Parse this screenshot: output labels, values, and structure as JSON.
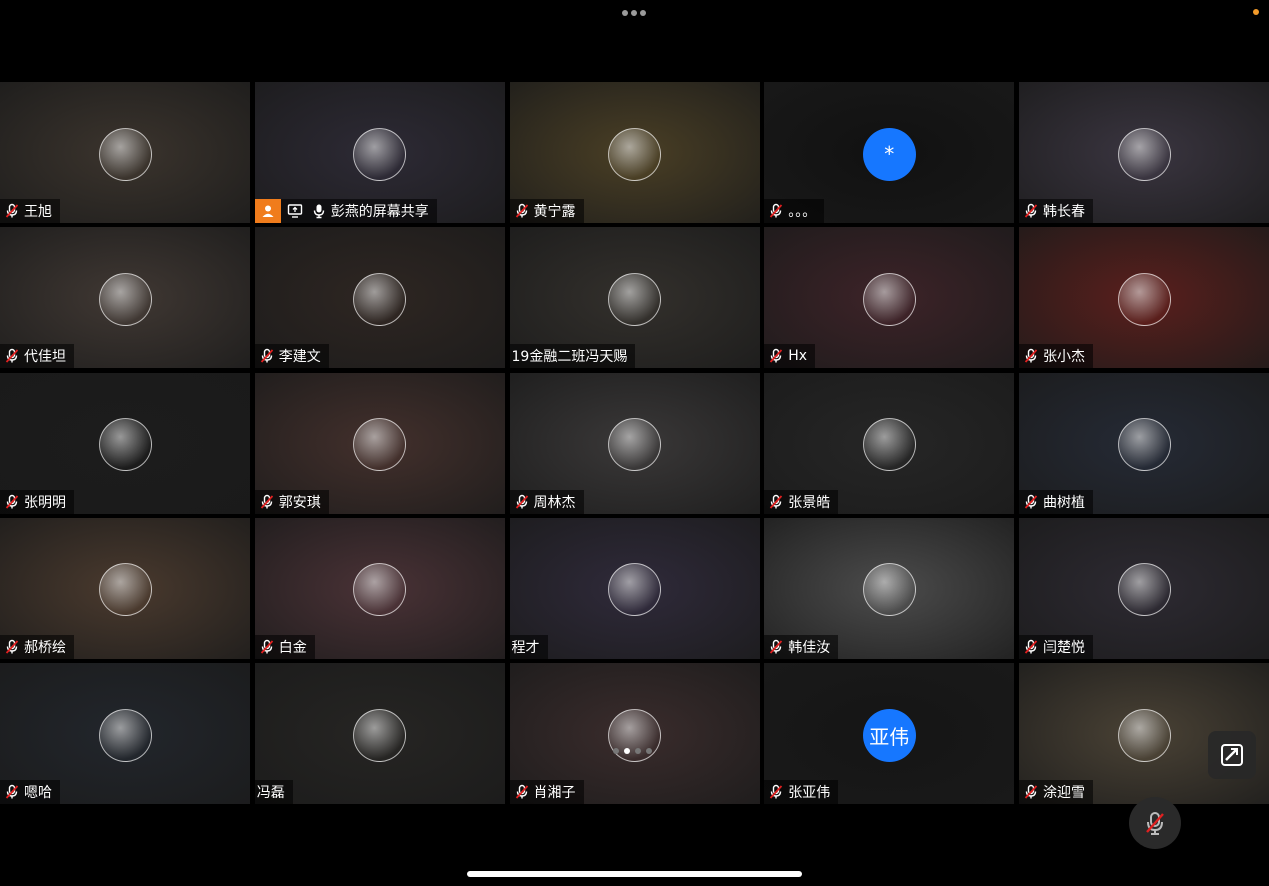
{
  "window": {
    "title": ""
  },
  "colors": {
    "accent_blue": "#1677ff",
    "share_orange": "#f07c1c",
    "status_dot": "#f39b2a",
    "muted_red": "#e02020"
  },
  "participants": [
    {
      "name": "王旭",
      "muted": true,
      "avatar": "photo",
      "bg": "#3b342d"
    },
    {
      "name": "彭燕的屏幕共享",
      "muted": false,
      "screen_share": true,
      "avatar": "photo",
      "bg": "#2d2a35"
    },
    {
      "name": "黄宁露",
      "muted": true,
      "avatar": "photo",
      "bg": "#4a3f25"
    },
    {
      "name": "。。。",
      "muted": true,
      "avatar": "solid",
      "avatar_text": "*",
      "avatar_color": "#1677ff",
      "bg": "#111111"
    },
    {
      "name": "韩长春",
      "muted": true,
      "avatar": "photo",
      "bg": "#3a3540"
    },
    {
      "name": "代佳坦",
      "muted": true,
      "avatar": "photo",
      "bg": "#403833"
    },
    {
      "name": "李建文",
      "muted": true,
      "avatar": "photo",
      "bg": "#2e2622"
    },
    {
      "name": "19金融二班冯天赐",
      "muted": false,
      "avatar": "photo",
      "bg": "#33302c"
    },
    {
      "name": "Hx",
      "muted": true,
      "avatar": "photo",
      "bg": "#3d2328"
    },
    {
      "name": "张小杰",
      "muted": true,
      "avatar": "photo",
      "bg": "#5a1f1c"
    },
    {
      "name": "张明明",
      "muted": true,
      "avatar": "photo",
      "bg": "#1c1c1c"
    },
    {
      "name": "郭安琪",
      "muted": true,
      "avatar": "photo",
      "bg": "#43302c"
    },
    {
      "name": "周林杰",
      "muted": true,
      "avatar": "photo",
      "bg": "#3a3838"
    },
    {
      "name": "张景皓",
      "muted": true,
      "avatar": "photo",
      "bg": "#262626"
    },
    {
      "name": "曲树植",
      "muted": true,
      "avatar": "photo",
      "bg": "#252a35"
    },
    {
      "name": "郝桥绘",
      "muted": true,
      "avatar": "photo",
      "bg": "#4a3a2e"
    },
    {
      "name": "白金",
      "muted": true,
      "avatar": "photo",
      "bg": "#4a3236"
    },
    {
      "name": "程才",
      "muted": false,
      "avatar": "photo",
      "bg": "#2f2a3a"
    },
    {
      "name": "韩佳汝",
      "muted": true,
      "avatar": "photo",
      "bg": "#4c4c4c"
    },
    {
      "name": "闫楚悦",
      "muted": true,
      "avatar": "photo",
      "bg": "#2d2a32"
    },
    {
      "name": "嗯哈",
      "muted": true,
      "avatar": "photo",
      "bg": "#22262c"
    },
    {
      "name": "冯磊",
      "muted": false,
      "avatar": "photo",
      "bg": "#262523"
    },
    {
      "name": "肖湘子",
      "muted": true,
      "avatar": "photo",
      "bg": "#3a2c2c"
    },
    {
      "name": "张亚伟",
      "muted": true,
      "avatar": "solid",
      "avatar_text": "亚伟",
      "avatar_color": "#1677ff",
      "bg": "#151515"
    },
    {
      "name": "涂迎雪",
      "muted": true,
      "avatar": "photo",
      "bg": "#4a4235"
    }
  ],
  "pager": {
    "pages": 4,
    "current": 2
  },
  "controls": {
    "rotate_icon": "screen-rotate-icon",
    "mute_icon": "mic-muted-icon"
  }
}
